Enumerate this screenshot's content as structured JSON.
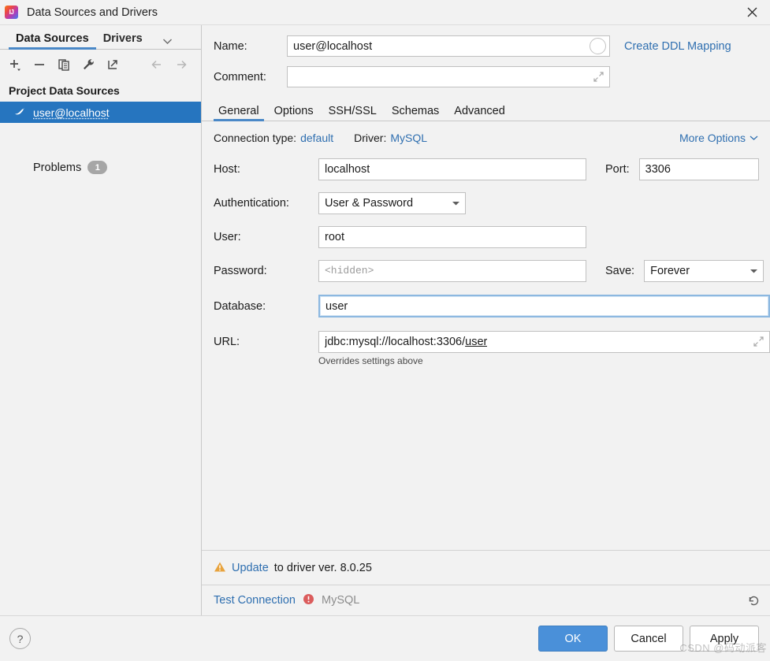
{
  "window": {
    "title": "Data Sources and Drivers",
    "app_icon": "intellij-idea-logo-icon",
    "close_icon": "close-icon"
  },
  "left_panel": {
    "tabs": [
      {
        "label": "Data Sources",
        "active": true
      },
      {
        "label": "Drivers",
        "active": false
      }
    ],
    "tabs_overflow_icon": "chevron-down-icon",
    "toolbar": [
      {
        "icon": "add-icon",
        "label": "Add",
        "enabled": true
      },
      {
        "icon": "remove-icon",
        "label": "Remove",
        "enabled": true
      },
      {
        "icon": "duplicate-icon",
        "label": "Duplicate",
        "enabled": true
      },
      {
        "icon": "wrench-icon",
        "label": "Properties",
        "enabled": true
      },
      {
        "icon": "export-icon",
        "label": "Export",
        "enabled": true
      },
      {
        "icon": "arrow-back-icon",
        "label": "Back",
        "enabled": false
      },
      {
        "icon": "arrow-forward-icon",
        "label": "Forward",
        "enabled": false
      }
    ],
    "section_header": "Project Data Sources",
    "data_sources": [
      {
        "name": "user@localhost",
        "icon": "mysql-dolphin-icon",
        "selected": true
      }
    ],
    "problems": {
      "label": "Problems",
      "count": "1"
    }
  },
  "form": {
    "name_label": "Name:",
    "name_value": "user@localhost",
    "name_color_tag_icon": "color-circle-icon",
    "create_ddl_mapping": "Create DDL Mapping",
    "comment_label": "Comment:",
    "comment_value": "",
    "comment_expand_icon": "expand-icon",
    "tabs": [
      {
        "label": "General",
        "active": true
      },
      {
        "label": "Options",
        "active": false
      },
      {
        "label": "SSH/SSL",
        "active": false
      },
      {
        "label": "Schemas",
        "active": false
      },
      {
        "label": "Advanced",
        "active": false
      }
    ],
    "connection_type_label": "Connection type:",
    "connection_type_value": "default",
    "driver_label": "Driver:",
    "driver_value": "MySQL",
    "more_options": "More Options",
    "more_options_icon": "chevron-down-icon",
    "host_label": "Host:",
    "host_value": "localhost",
    "port_label": "Port:",
    "port_value": "3306",
    "auth_label": "Authentication:",
    "auth_value": "User & Password",
    "user_label": "User:",
    "user_value": "root",
    "password_label": "Password:",
    "password_placeholder": "<hidden>",
    "save_label": "Save:",
    "save_value": "Forever",
    "database_label": "Database:",
    "database_value": "user",
    "url_label": "URL:",
    "url_prefix": "jdbc:mysql://localhost:3306/",
    "url_suffix": "user",
    "url_expand_icon": "expand-icon",
    "overrides_note": "Overrides settings above"
  },
  "notices": {
    "warning_icon": "warning-triangle-icon",
    "update_link": "Update",
    "update_rest": "to driver ver. 8.0.25",
    "test_connection": "Test Connection",
    "error_icon": "error-badge-icon",
    "test_driver": "MySQL",
    "revert_icon": "revert-icon"
  },
  "footer": {
    "help_icon": "help-icon",
    "ok": "OK",
    "cancel": "Cancel",
    "apply": "Apply"
  },
  "watermark": "CSDN @码动派客",
  "colors": {
    "accent_blue": "#4a88c7",
    "selection_blue": "#2675bf",
    "link_blue": "#2f6fb0",
    "primary_button": "#4a90d9",
    "warning_yellow": "#e8a33d",
    "error_red": "#db5c5c",
    "background": "#f2f2f2"
  }
}
